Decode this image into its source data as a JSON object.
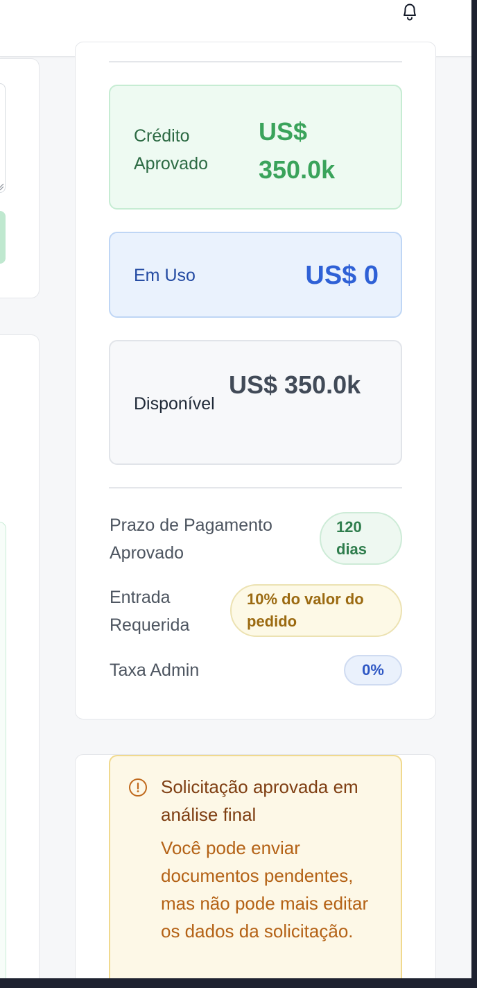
{
  "header": {
    "notifications_icon": "bell-icon"
  },
  "credit": {
    "approved": {
      "label": "Crédito Aprovado",
      "value": "US$ 350.0k"
    },
    "in_use": {
      "label": "Em Uso",
      "value": "US$ 0"
    },
    "available": {
      "label": "Disponível",
      "value": "US$ 350.0k"
    }
  },
  "terms": {
    "payment_term": {
      "label": "Prazo de Pagamento Aprovado",
      "value": "120 dias"
    },
    "down_payment": {
      "label": "Entrada Requerida",
      "value": "10% do valor do pedido"
    },
    "admin_fee": {
      "label": "Taxa Admin",
      "value": "0%"
    }
  },
  "notice": {
    "icon": "alert-circle-icon",
    "title": "Solicitação aprovada em análise final",
    "text": "Você pode enviar documentos pendentes, mas não pode mais editar os dados da solicitação."
  },
  "colors": {
    "approved": "#3aa35b",
    "in_use": "#2f61d6",
    "available": "#414a57",
    "warning": "#b46216"
  }
}
